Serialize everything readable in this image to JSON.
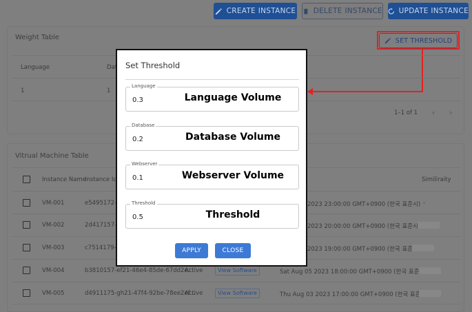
{
  "toolbar": {
    "create_label": "CREATE INSTANCE",
    "delete_label": "DELETE INSTANCE",
    "update_label": "UPDATE INSTANCE"
  },
  "weight_table": {
    "title": "Weight Table",
    "set_threshold_label": "SET THRESHOLD",
    "columns": [
      "Language",
      "Dat"
    ],
    "row": [
      "1",
      "1"
    ],
    "pagination": "1–1 of 1"
  },
  "vm_table": {
    "title": "Vitrual Machine Table",
    "columns": {
      "name": "Instance Name",
      "id": "Instance Id",
      "similarity": "Similiraity"
    },
    "rows": [
      {
        "name": "VM-001",
        "id": "e5495172-62",
        "status": "",
        "software": "",
        "date": "2023 23:00:00 GMT+0900 (한국 표준시)",
        "similarity": "-"
      },
      {
        "name": "VM-002",
        "id": "2d417157-ac",
        "status": "",
        "software": "",
        "date": "2023 20:00:00 GMT+0900 (한국 표준시)",
        "similarity": ""
      },
      {
        "name": "VM-003",
        "id": "c7514179-de",
        "status": "",
        "software": "",
        "date": "2023 19:00:00 GMT+0900 (한국 표준시)",
        "similarity": ""
      },
      {
        "name": "VM-004",
        "id": "b3810157-ef21-46e4-85de-67dd2e...",
        "status": "Active",
        "software": "View Software",
        "date": "Sat Aug 05 2023 18:00:00 GMT+0900 (한국 표준시)",
        "similarity": ""
      },
      {
        "name": "VM-005",
        "id": "d4911175-gh21-47f4-92be-78ee2ef...",
        "status": "Active",
        "software": "View Software",
        "date": "Thu Aug 03 2023 17:00:00 GMT+0900 (한국 표준시)",
        "similarity": ""
      }
    ]
  },
  "modal": {
    "title": "Set Threshold",
    "fields": [
      {
        "label": "Language",
        "value": "0.3",
        "annotation": "Language Volume"
      },
      {
        "label": "Database",
        "value": "0.2",
        "annotation": "Database Volume"
      },
      {
        "label": "Webserver",
        "value": "0.1",
        "annotation": "Webserver Volume"
      },
      {
        "label": "Threshold",
        "value": "0.5",
        "annotation": "Threshold"
      }
    ],
    "apply_label": "APPLY",
    "close_label": "CLOSE"
  },
  "colors": {
    "overlay_background": "#7f7f7f",
    "primary_button": "#1f4f94",
    "modal_button": "#3d7ad6",
    "highlight_red": "#e52020"
  }
}
